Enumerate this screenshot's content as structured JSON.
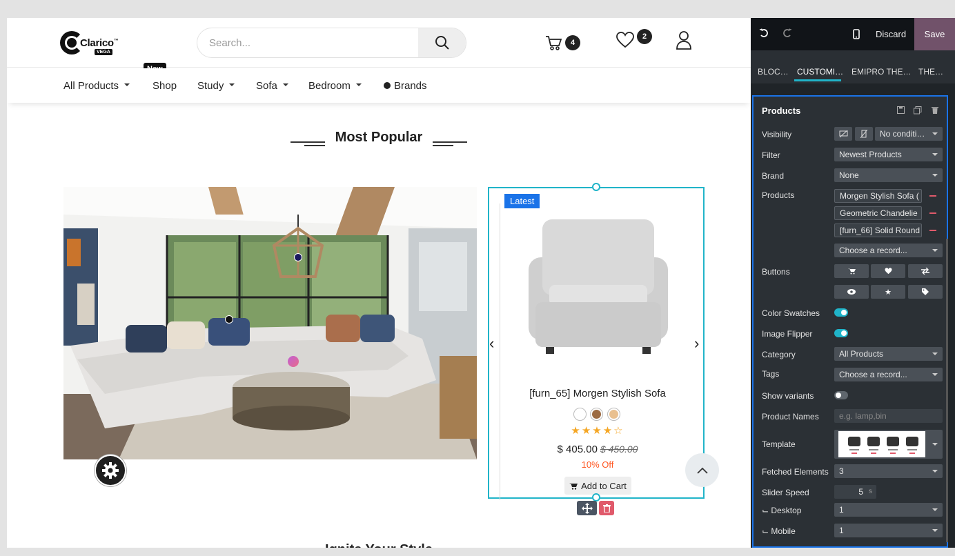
{
  "header": {
    "logo_text": "Clarico",
    "logo_tm": "™",
    "logo_sub": "VEGA",
    "search_placeholder": "Search...",
    "cart_count": "4",
    "wishlist_count": "2"
  },
  "nav": {
    "items": [
      {
        "label": "All Products",
        "dropdown": true
      },
      {
        "label": "Shop",
        "dropdown": false
      },
      {
        "label": "Study",
        "dropdown": true
      },
      {
        "label": "Sofa",
        "dropdown": true
      },
      {
        "label": "Bedroom",
        "dropdown": true
      },
      {
        "label": "Brands",
        "dropdown": false
      }
    ],
    "new_badge": "New"
  },
  "section": {
    "title": "Most Popular",
    "next_title": "Ignite Your Style"
  },
  "product": {
    "badge": "Latest",
    "name": "[furn_65] Morgen Stylish Sofa",
    "swatch_colors": [
      "#ffffff",
      "#9c6b43",
      "#e9c08f"
    ],
    "rating": "4",
    "stars": "★★★★☆",
    "price": "$ 405.00",
    "old_price": "$ 450.00",
    "discount": "10% Off",
    "add_to_cart": "Add to Cart"
  },
  "editor": {
    "discard": "Discard",
    "save": "Save",
    "tabs": [
      {
        "label": "BLOC…",
        "active": false
      },
      {
        "label": "CUSTOMI…",
        "active": true
      },
      {
        "label": "EMIPRO THE…",
        "active": false
      },
      {
        "label": "THE…",
        "active": false
      }
    ],
    "snippet_title": "Products",
    "fields": {
      "visibility_label": "Visibility",
      "visibility_value": "No conditi…",
      "filter_label": "Filter",
      "filter_value": "Newest Products",
      "brand_label": "Brand",
      "brand_value": "None",
      "products_label": "Products",
      "products": [
        "Morgen Stylish Sofa (",
        "Geometric Chandelie",
        "[furn_66] Solid Round"
      ],
      "choose_record": "Choose a record...",
      "buttons_label": "Buttons",
      "color_swatches_label": "Color Swatches",
      "image_flipper_label": "Image Flipper",
      "category_label": "Category",
      "category_value": "All Products",
      "tags_label": "Tags",
      "tags_value": "Choose a record...",
      "show_variants_label": "Show variants",
      "product_names_label": "Product Names",
      "product_names_placeholder": "e.g. lamp,bin",
      "template_label": "Template",
      "fetched_label": "Fetched Elements",
      "fetched_value": "3",
      "slider_speed_label": "Slider Speed",
      "slider_speed_value": "5",
      "slider_speed_unit": "s",
      "desktop_label": "⌙ Desktop",
      "desktop_value": "1",
      "mobile_label": "⌙ Mobile",
      "mobile_value": "1"
    },
    "toggles": {
      "color_swatches": true,
      "image_flipper": true,
      "show_variants": false
    },
    "accent": "#20b4c9",
    "save_color": "#71526a"
  }
}
